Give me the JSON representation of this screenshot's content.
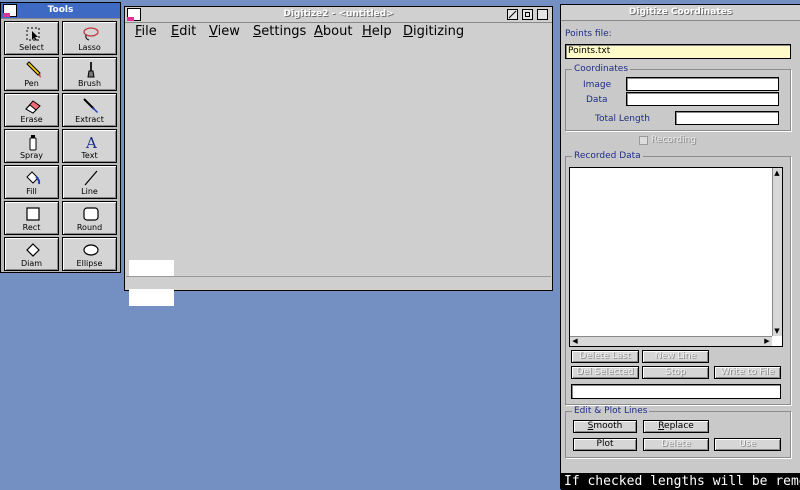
{
  "tools_window": {
    "title": "Tools",
    "tools": [
      {
        "label": "Select",
        "icon": "select-icon"
      },
      {
        "label": "Lasso",
        "icon": "lasso-icon"
      },
      {
        "label": "Pen",
        "icon": "pen-icon"
      },
      {
        "label": "Brush",
        "icon": "brush-icon"
      },
      {
        "label": "Erase",
        "icon": "eraser-icon"
      },
      {
        "label": "Extract",
        "icon": "extract-icon"
      },
      {
        "label": "Spray",
        "icon": "spray-icon"
      },
      {
        "label": "Text",
        "icon": "text-icon"
      },
      {
        "label": "Fill",
        "icon": "fill-icon"
      },
      {
        "label": "Line",
        "icon": "line-icon"
      },
      {
        "label": "Rect",
        "icon": "rect-icon"
      },
      {
        "label": "Round",
        "icon": "round-rect-icon"
      },
      {
        "label": "Diam",
        "icon": "diamond-icon"
      },
      {
        "label": "Ellipse",
        "icon": "ellipse-icon"
      }
    ]
  },
  "main_window": {
    "title": "Digitize2 - <untitled>",
    "menu": [
      {
        "label": "File",
        "mnemonic": "F",
        "rest": "ile"
      },
      {
        "label": "Edit",
        "mnemonic": "E",
        "rest": "dit"
      },
      {
        "label": "View",
        "mnemonic": "V",
        "rest": "iew"
      },
      {
        "label": "Settings",
        "mnemonic": "S",
        "rest": "ettings"
      },
      {
        "label": "About",
        "mnemonic": "A",
        "rest": "bout"
      },
      {
        "label": "Help",
        "mnemonic": "H",
        "rest": "elp"
      },
      {
        "label": "Digitizing",
        "mnemonic": "D",
        "rest": "igitizing"
      }
    ]
  },
  "coord_window": {
    "title": "Digitize Coordinates",
    "points_file_label": "Points file:",
    "points_file_value": "Points.txt",
    "coordinates_group": "Coordinates",
    "image_label": "Image",
    "image_value": "",
    "data_label": "Data",
    "data_value": "",
    "total_length_label": "Total Length",
    "total_length_value": "",
    "recording_label": "Recording",
    "recorded_group": "Recorded Data",
    "buttons_row1": [
      "Delete Last",
      "New Line"
    ],
    "buttons_row2": [
      "Del Selected",
      "Stop",
      "Write to File"
    ],
    "message_value": "",
    "edit_group": "Edit & Plot Lines",
    "smooth": {
      "mnemonic": "S",
      "rest": "mooth"
    },
    "replace": {
      "mnemonic": "R",
      "rest": "eplace"
    },
    "plot": "Plot",
    "delete": "Delete",
    "use": "Use",
    "bottom_message": "If checked lengths will be remer"
  },
  "colors": {
    "desktop": "#7490c2",
    "active_title": "#3f6ac4",
    "window_bg": "#cfcfcf",
    "field_yellow": "#fffbc8",
    "label_blue": "#1d2d86"
  }
}
